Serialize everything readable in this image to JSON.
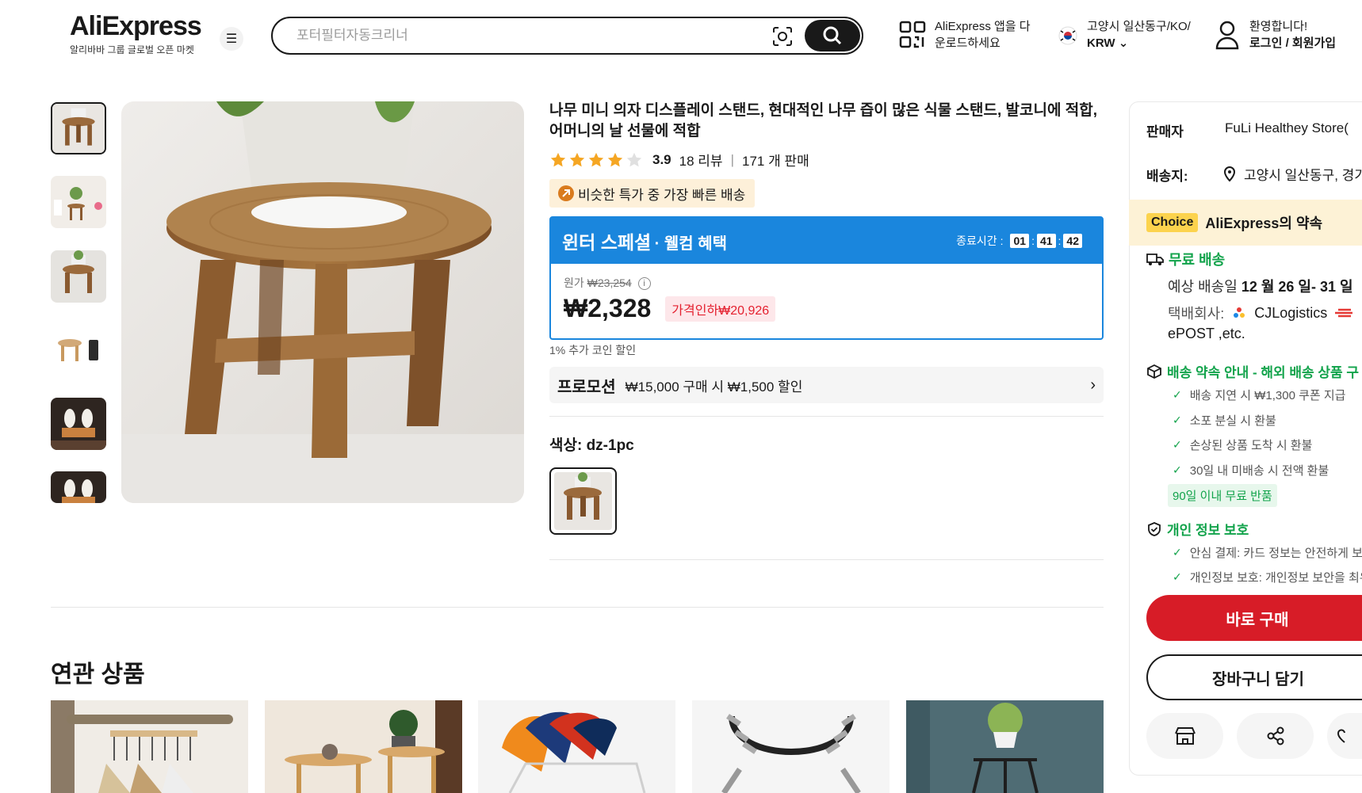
{
  "header": {
    "logo": "AliExpress",
    "logo_sub": "알리바바 그룹 글로벌 오픈 마켓",
    "search_placeholder": "포터필터자동크리너",
    "app_line1": "AliExpress 앱을 다",
    "app_line2": "운로드하세요",
    "location_line1": "고양시 일산동구/KO/",
    "location_line2": "KRW",
    "account_line1": "환영합니다!",
    "account_line2": "로그인 / 회원가입"
  },
  "product": {
    "title": "나무 미니 의자 디스플레이 스탠드, 현대적인 나무 즙이 많은 식물 스탠드, 발코니에 적합, 어머니의 날 선물에 적합",
    "rating": "3.9",
    "reviews": "18 리뷰",
    "sold": "171 개 판매",
    "stars_filled": 4,
    "fast_shipping": "비슷한 특가 중 가장 빠른 배송",
    "promo_title": "윈터 스페셜",
    "promo_subtitle": "· 웰컴 혜택",
    "ends_label": "종료시간 :",
    "timer": [
      "01",
      "41",
      "42"
    ],
    "original_price_label": "원가",
    "original_price": "₩23,254",
    "price": "₩2,328",
    "discount": "가격인하₩20,926",
    "coin_discount": "1% 추가 코인 할인",
    "promotion_label": "프로모션",
    "promotion_text": "₩15,000 구매 시 ₩1,500 할인",
    "color_label": "색상: dz-1pc"
  },
  "related": {
    "title": "연관 상품"
  },
  "panel": {
    "seller_label": "판매자",
    "seller_name": "FuLi Healthey Store(",
    "ship_to_label": "배송지:",
    "ship_to_value": "고양시 일산동구, 경기",
    "choice_tag": "Choice",
    "choice_text": "AliExpress의 약속",
    "free_shipping": "무료 배송",
    "eta_prefix": "예상 배송일",
    "eta_value": "12 월 26 일- 31 일",
    "carrier_label": "택배회사:",
    "carrier_value": "CJLogistics",
    "carrier_more": "ePOST ,etc.",
    "guarantee_title": "배송 약속 안내 - 해외 배송 상품 구",
    "guarantee_items": [
      "배송 지연 시 ₩1,300 쿠폰 지급",
      "소포 분실 시 환불",
      "손상된 상품 도착 시 환불",
      "30일 내 미배송 시 전액 환불"
    ],
    "return_badge": "90일 이내 무료 반품",
    "privacy_title": "개인 정보 보호",
    "privacy_items": [
      "안심 결제: 카드 정보는 안전하게 보",
      "개인정보 보호: 개인정보 보안을 최우"
    ],
    "buy_now": "바로 구매",
    "add_cart": "장바구니 담기"
  }
}
